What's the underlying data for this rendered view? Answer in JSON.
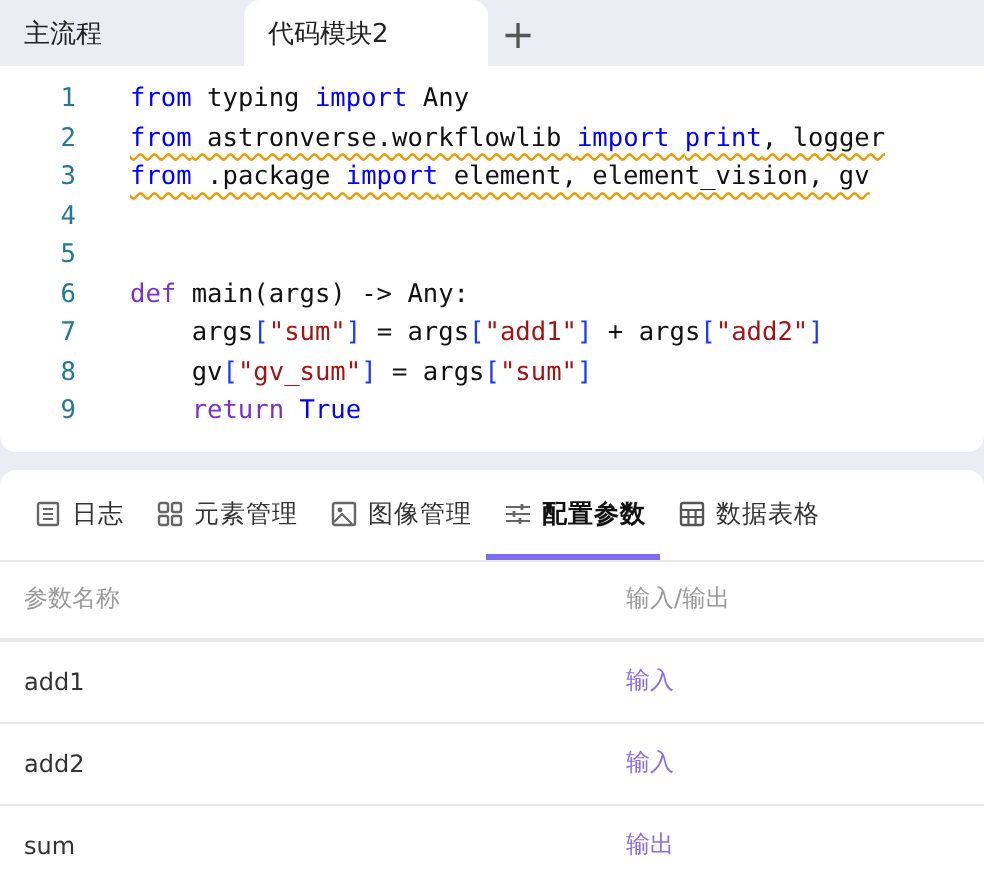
{
  "tabs": [
    {
      "label": "主流程",
      "selected": false
    },
    {
      "label": "代码模块2",
      "selected": true
    }
  ],
  "add_tab": {
    "label": "+"
  },
  "editor": {
    "lines": [
      {
        "number": "1",
        "warning": false,
        "tokens": [
          {
            "text": "from",
            "kind": "keyword"
          },
          {
            "text": " typing ",
            "kind": "plain"
          },
          {
            "text": "import",
            "kind": "keyword"
          },
          {
            "text": " Any",
            "kind": "plain"
          }
        ]
      },
      {
        "number": "2",
        "warning": true,
        "tokens": [
          {
            "text": "from",
            "kind": "keyword"
          },
          {
            "text": " astronverse.workflowlib ",
            "kind": "plain"
          },
          {
            "text": "import ",
            "kind": "keyword"
          },
          {
            "text": "print",
            "kind": "keyword"
          },
          {
            "text": ", logger",
            "kind": "plain"
          }
        ]
      },
      {
        "number": "3",
        "warning": true,
        "tokens": [
          {
            "text": "from",
            "kind": "keyword"
          },
          {
            "text": " .package ",
            "kind": "plain"
          },
          {
            "text": "import",
            "kind": "keyword"
          },
          {
            "text": " element, element_vision, gv",
            "kind": "plain"
          }
        ]
      },
      {
        "number": "4"
      },
      {
        "number": "5"
      },
      {
        "number": "6",
        "warning": false,
        "tokens": [
          {
            "text": "def",
            "kind": "control"
          },
          {
            "text": " main(args) -> Any:",
            "kind": "plain"
          }
        ]
      },
      {
        "number": "7",
        "warning": false,
        "tokens": [
          {
            "text": "    args",
            "kind": "plain"
          },
          {
            "text": "[",
            "kind": "bracket"
          },
          {
            "text": "\"sum\"",
            "kind": "string"
          },
          {
            "text": "]",
            "kind": "bracket"
          },
          {
            "text": " = args",
            "kind": "plain"
          },
          {
            "text": "[",
            "kind": "bracket"
          },
          {
            "text": "\"add1\"",
            "kind": "string"
          },
          {
            "text": "]",
            "kind": "bracket"
          },
          {
            "text": " + args",
            "kind": "plain"
          },
          {
            "text": "[",
            "kind": "bracket"
          },
          {
            "text": "\"add2\"",
            "kind": "string"
          },
          {
            "text": "]",
            "kind": "bracket"
          }
        ]
      },
      {
        "number": "8",
        "warning": false,
        "tokens": [
          {
            "text": "    gv",
            "kind": "plain"
          },
          {
            "text": "[",
            "kind": "bracket"
          },
          {
            "text": "\"gv_sum\"",
            "kind": "string"
          },
          {
            "text": "]",
            "kind": "bracket"
          },
          {
            "text": " = args",
            "kind": "plain"
          },
          {
            "text": "[",
            "kind": "bracket"
          },
          {
            "text": "\"sum\"",
            "kind": "string"
          },
          {
            "text": "]",
            "kind": "bracket"
          }
        ]
      },
      {
        "number": "9",
        "warning": false,
        "tokens": [
          {
            "text": "    return",
            "kind": "control"
          },
          {
            "text": " True",
            "kind": "keyword"
          }
        ]
      }
    ]
  },
  "panel_tabs": [
    {
      "label": "日志",
      "selected": false
    },
    {
      "label": "元素管理",
      "selected": false
    },
    {
      "label": "图像管理",
      "selected": false
    },
    {
      "label": "配置参数",
      "selected": true
    },
    {
      "label": "数据表格",
      "selected": false
    }
  ],
  "table": {
    "columns": [
      "参数名称",
      "输入/输出"
    ],
    "rows": [
      {
        "name": "add1",
        "direction": "输入"
      },
      {
        "name": "add2",
        "direction": "输入"
      },
      {
        "name": "sum",
        "direction": "输出"
      }
    ]
  }
}
